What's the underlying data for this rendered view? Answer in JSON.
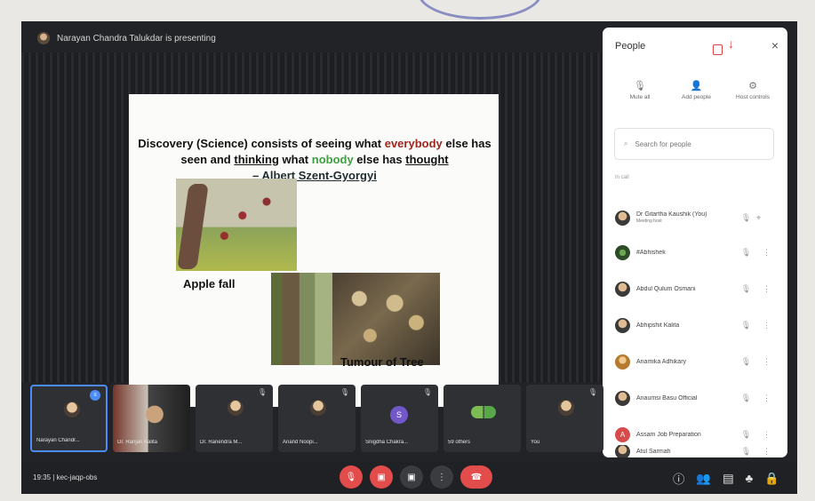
{
  "meeting": {
    "presenter_status": "Narayan Chandra Talukdar is presenting",
    "meeting_code": "kec-jaqp-obs",
    "time": "19:35",
    "slide": {
      "quote_parts": [
        "Discovery (Science) consists of seeing what ",
        "everybody",
        " else has seen and ",
        "thinking",
        " what ",
        "nobody",
        " else has ",
        "thought",
        "– Albert Szent-Gyorgyi"
      ],
      "captions": {
        "apple": "Apple fall",
        "tumour": "Tumour of Tree"
      },
      "controls": [
        "",
        "",
        "",
        ""
      ]
    },
    "participants_strip": [
      {
        "name": "Narayan Chandr...",
        "state": "speaking"
      },
      {
        "name": "Dr. Ranjan Kalita",
        "state": "video"
      },
      {
        "name": "Dr. Ranendra M...",
        "state": "muted"
      },
      {
        "name": "Anand Noopi...",
        "state": "muted"
      },
      {
        "name": "Snigdha Chakra...",
        "state": "muted"
      },
      {
        "name": "59 others",
        "state": "group"
      },
      {
        "name": "You",
        "state": "muted"
      }
    ]
  },
  "people_panel": {
    "title": "People",
    "actions": [
      {
        "label": "Mute all",
        "icon": "mic-off-icon"
      },
      {
        "label": "Add people",
        "icon": "add-person-icon"
      },
      {
        "label": "Host controls",
        "icon": "settings-icon"
      }
    ],
    "search_placeholder": "Search for people",
    "section_label": "In call",
    "people": [
      {
        "name": "Dr Gitartha Kaushik (You)",
        "sub": "Meeting host",
        "avatar_type": "photo",
        "trailing": "pin"
      },
      {
        "name": "#Abhishek",
        "sub": "",
        "avatar_type": "plant",
        "trailing": "more"
      },
      {
        "name": "Abdul Qulum Osmani",
        "sub": "",
        "avatar_type": "photo",
        "trailing": "more"
      },
      {
        "name": "Abhipshit Kalita",
        "sub": "",
        "avatar_type": "photo",
        "trailing": "more"
      },
      {
        "name": "Anamika Adhikary",
        "sub": "",
        "avatar_type": "gold",
        "trailing": "more"
      },
      {
        "name": "Anaumsi Basu Official",
        "sub": "",
        "avatar_type": "photo",
        "trailing": "more"
      },
      {
        "name": "Assam Job Preparation",
        "sub": "",
        "avatar_type": "letter",
        "letter": "A",
        "trailing": "more"
      },
      {
        "name": "Atul Sarmah",
        "sub": "",
        "avatar_type": "photo",
        "trailing": "more"
      }
    ]
  },
  "icons": {
    "close": "close-icon",
    "search": "search-icon",
    "mic_off": "mic-off-icon",
    "camera_off": "camera-off-icon",
    "present": "present-icon",
    "more": "more-vert-icon",
    "hang_up": "phone-hangup-icon",
    "info": "info-icon",
    "people": "people-icon",
    "chat": "chat-icon",
    "activities": "activities-icon",
    "lock": "lock-icon"
  },
  "colors": {
    "meeting_bg": "#222326",
    "accent_red": "#e24c4b",
    "speaking_blue": "#4c8cf6",
    "quote_red": "#9d261e",
    "quote_green": "#3f9f42"
  }
}
